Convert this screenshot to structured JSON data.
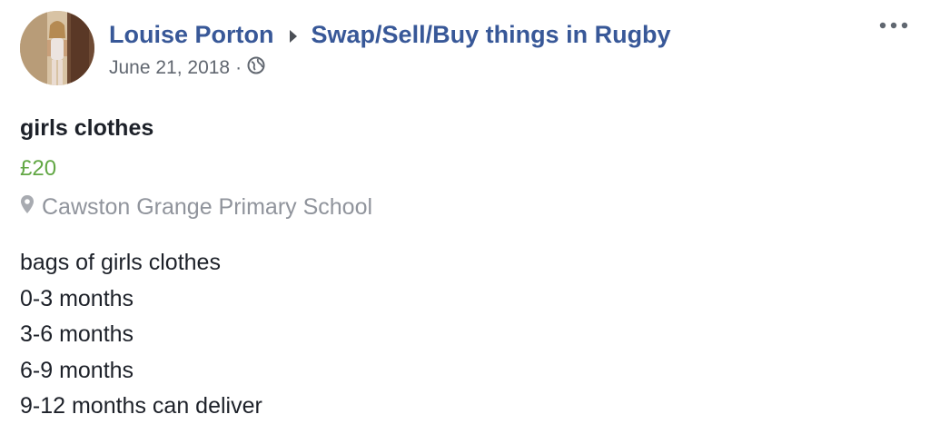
{
  "post": {
    "author": "Louise Porton",
    "group": "Swap/Sell/Buy things in Rugby",
    "date": "June 21, 2018",
    "separator": "·",
    "privacy_icon": "globe-icon",
    "more_icon": "more-options-icon"
  },
  "listing": {
    "title": "girls clothes",
    "price": "£20",
    "price_color": "#62a744",
    "location": "Cawston Grange Primary School",
    "description": [
      "bags of girls clothes",
      "0-3 months",
      "3-6 months",
      "6-9 months",
      "9-12 months can deliver"
    ]
  },
  "colors": {
    "link": "#385898",
    "meta": "#616770",
    "text": "#1d2129",
    "muted": "#90949c"
  }
}
